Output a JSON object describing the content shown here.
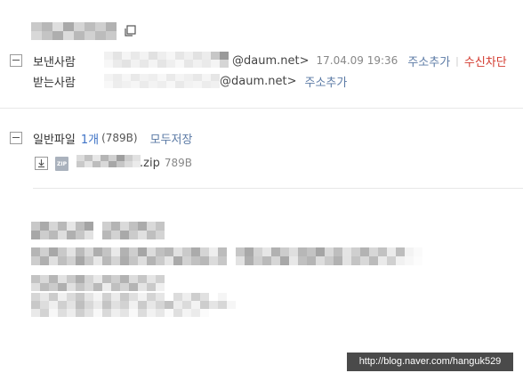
{
  "header": {
    "copy_icon": "copy-icon"
  },
  "sender": {
    "label": "보낸사람",
    "domain": "@daum.net>",
    "datetime": "17.04.09 19:36",
    "add_contact": "주소추가",
    "block": "수신차단",
    "separator": "|"
  },
  "recipient": {
    "label": "받는사람",
    "domain": "@daum.net>",
    "add_contact": "주소추가"
  },
  "attachments": {
    "label": "일반파일",
    "count": "1개",
    "total_size": "(789B)",
    "save_all": "모두저장",
    "files": [
      {
        "name_suffix": ".zip",
        "size": "789B",
        "icon": "zip-file-icon"
      }
    ]
  },
  "colors": {
    "link": "#5b7aa5",
    "count": "#3f73c6",
    "block": "#d33a2f",
    "watermark_bg": "#4a4a4a"
  },
  "watermark": "http://blog.naver.com/hanguk529"
}
